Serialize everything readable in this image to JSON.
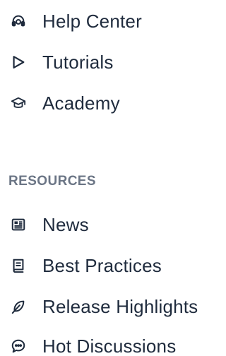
{
  "menu_top": {
    "items": [
      {
        "label": "Help Center",
        "icon": "headset-icon"
      },
      {
        "label": "Tutorials",
        "icon": "play-icon"
      },
      {
        "label": "Academy",
        "icon": "graduation-cap-icon"
      }
    ]
  },
  "resources": {
    "heading": "RESOURCES",
    "items": [
      {
        "label": "News",
        "icon": "newspaper-icon"
      },
      {
        "label": "Best Practices",
        "icon": "book-icon"
      },
      {
        "label": "Release Highlights",
        "icon": "feather-icon"
      },
      {
        "label": "Hot Discussions",
        "icon": "chat-icon"
      }
    ]
  },
  "colors": {
    "text": "#1f2b3d",
    "heading": "#6b7585",
    "background": "#ffffff"
  }
}
